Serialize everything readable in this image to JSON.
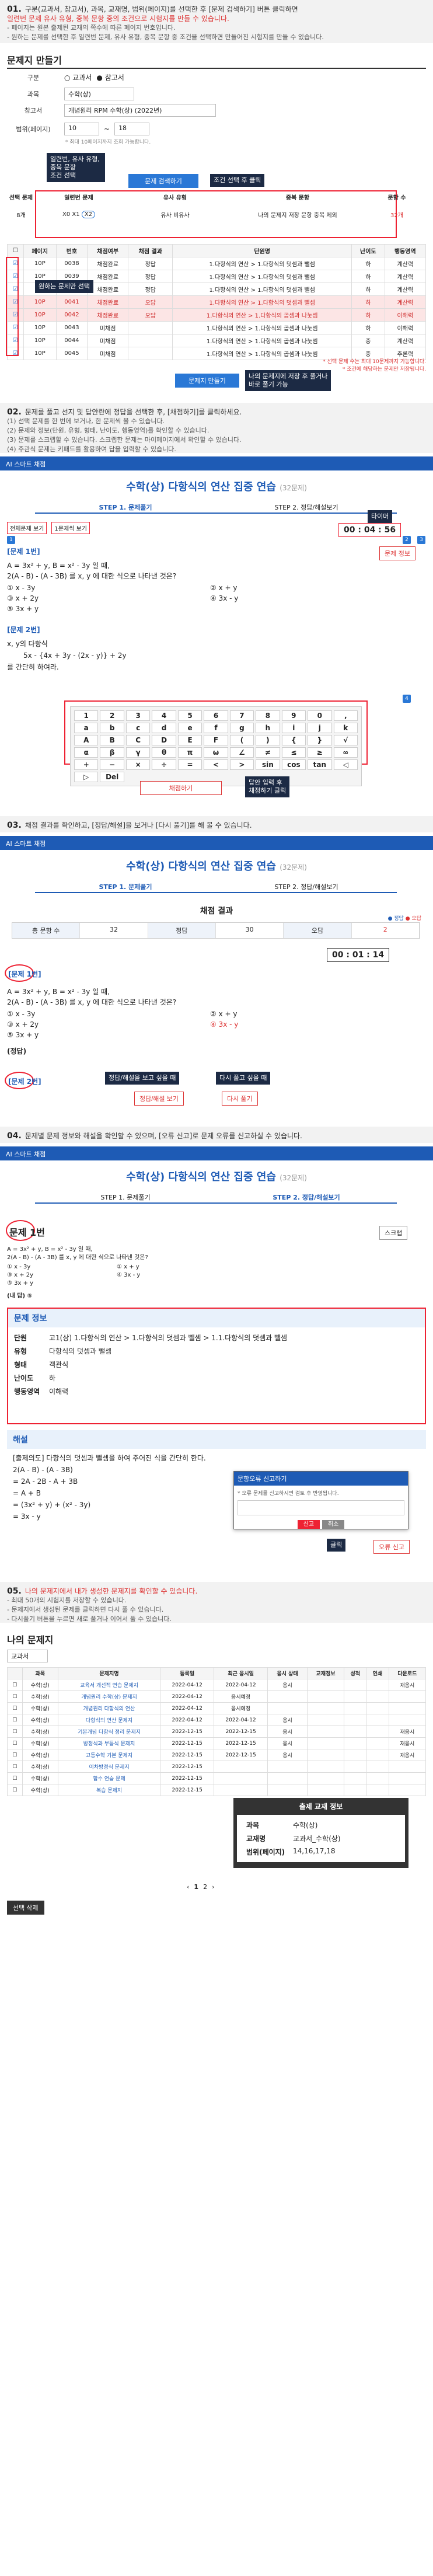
{
  "s1": {
    "num": "01.",
    "lines": [
      "구분(교과서, 참고서), 과목, 교재명, 범위(페이지)를 선택한 후 [문제 검색하기] 버튼 클릭하면",
      "일련번 문제 유사 유형, 중복 문항 중의 조건으로 시험지를 만들 수 있습니다.",
      "- 페이지는 원본 출제된 교재의 쪽수에 따른 페이지 번호입니다.",
      "- 원하는 문제를 선택한 후 일련번 문제, 유사 유형, 중복 문항 중 조건을 선택하면 만들어진 시험지를 만들 수 있습니다."
    ],
    "heading": "문제지 만들기",
    "form": {
      "gubun_label": "구분",
      "gubun_options": [
        "교과서",
        "참고서"
      ],
      "subject_label": "과목",
      "subject_value": "수학(상)",
      "book_label": "참고서",
      "book_value": "개념원리 RPM 수학(상) (2022년)",
      "range_label": "범위(페이지)",
      "range_from": "10",
      "range_to": "18",
      "range_help": "* 최대 10페이지까지 조회 가능합니다."
    },
    "search_button": "문제 검색하기",
    "callout_search": "조건 선택 후 클릭",
    "callout_types": "일련번, 유사 유형, 중복 문항\n조건 선택",
    "filter_cols": [
      "선택 문제",
      "일련번 문제",
      "유사 유형",
      "중복 문항",
      "문항 수"
    ],
    "filter_sub": [
      "X0",
      "X1",
      "X2",
      "X3",
      "유사",
      "비유사",
      "X0",
      "X1",
      "X2",
      "나의 문제지 저장 문항",
      "중복",
      "제외"
    ],
    "filter_count": "32개",
    "table_headers": [
      "",
      "페이지",
      "번호",
      "채점여부",
      "채점 결과",
      "",
      "단원명",
      "난이도",
      "행동영역"
    ],
    "rows": [
      [
        "10P",
        "0038",
        "채점완료",
        "정답",
        "1.다항식의 연산 > 1.다항식의 덧셈과 뺄셈",
        "하",
        "계산력"
      ],
      [
        "10P",
        "0039",
        "채점완료",
        "정답",
        "1.다항식의 연산 > 1.다항식의 덧셈과 뺄셈",
        "하",
        "계산력"
      ],
      [
        "10P",
        "0040",
        "채점완료",
        "정답",
        "1.다항식의 연산 > 1.다항식의 덧셈과 뺄셈",
        "하",
        "계산력"
      ],
      [
        "10P",
        "0041",
        "채점완료",
        "오답",
        "1.다항식의 연산 > 1.다항식의 덧셈과 뺄셈",
        "하",
        "계산력"
      ],
      [
        "10P",
        "0042",
        "채점완료",
        "오답",
        "1.다항식의 연산 > 1.다항식의 곱셈과 나눗셈",
        "하",
        "이해력"
      ],
      [
        "10P",
        "0043",
        "미채점",
        "",
        "1.다항식의 연산 > 1.다항식의 곱셈과 나눗셈",
        "하",
        "이해력"
      ],
      [
        "10P",
        "0044",
        "미채점",
        "",
        "1.다항식의 연산 > 1.다항식의 곱셈과 나눗셈",
        "중",
        "계산력"
      ],
      [
        "10P",
        "0045",
        "미채점",
        "",
        "1.다항식의 연산 > 1.다항식의 곱셈과 나눗셈",
        "중",
        "추론력"
      ]
    ],
    "callout_select": "원하는 문제만 선택",
    "right_note": "* 선택 문제 수는 최대 10문제까지 가능합니다.\n* 조건에 해당하는 문제만 저장됩니다.",
    "make_button": "문제지 만들기",
    "callout_make": "나의 문제지에 저장 후 풀거나\n바로 풀기 가능"
  },
  "s2": {
    "num": "02.",
    "lines": [
      "문제를 풀고 선지 및 답안란에 정답을 선택한 후, [채점하기]를 클릭하세요.",
      "(1) 선택 문제를 한 번에 보거나, 한 문제씩 볼 수 있습니다.",
      "(2) 문제와 정보(단원, 유형, 형태, 난이도, 행동영역)를 확인할 수 있습니다.",
      "(3) 문제를 스크랩할 수 있습니다. 스크랩한 문제는 마이페이지에서 확인할 수 있습니다.",
      "(4) 주관식 문제는 키패드를 활용하여 답을 입력할 수 있습니다."
    ],
    "bar": "AI 스마트 채점",
    "title": "수학(상) 다항식의 연산 집중 연습",
    "title_count": "(32문제)",
    "step1": "STEP 1. 문제풀기",
    "step2": "STEP 2. 정답/해설보기",
    "toggles": [
      "전체문제 보기",
      "1문제씩 보기"
    ],
    "timer": "00 : 04 : 56",
    "timer_label": "타이머",
    "info_btn": "문제 정보",
    "q1_label": "[문제 1번]",
    "q1_text": "A = 3x² + y, B = x² - 3y 일 때,",
    "q1_text2": "2(A - B) - (A - 3B) 를 x, y 에 대한 식으로 나타낸 것은?",
    "q1_choices": [
      "① x - 3y",
      "② x + y",
      "③ x + 2y",
      "④ 3x - y",
      "⑤ 3x + y"
    ],
    "q2_label": "[문제 2번]",
    "q2_text": "x, y의 다항식",
    "q2_expr": "5x - {4x + 3y - (2x - y)} + 2y",
    "q2_text2": "를 간단히 하여라.",
    "keys": [
      "1",
      "2",
      "3",
      "4",
      "5",
      "6",
      "7",
      "8",
      "9",
      "0",
      ",",
      "a",
      "b",
      "c",
      "d",
      "e",
      "f",
      "g",
      "h",
      "i",
      "j",
      "k",
      "A",
      "B",
      "C",
      "D",
      "E",
      "F",
      "(",
      ")",
      "{",
      "}",
      "√",
      "α",
      "β",
      "γ",
      "θ",
      "π",
      "ω",
      "∠",
      "≠",
      "≤",
      "≥",
      "∞",
      "+",
      "−",
      "×",
      "÷",
      "=",
      "<",
      ">",
      "sin",
      "cos",
      "tan",
      "◁",
      "▷",
      "Del"
    ],
    "grade_button": "채점하기",
    "callout_grade": "답안 입력 후\n채점하기 클릭"
  },
  "s3": {
    "num": "03.",
    "lines": [
      "채점 결과를 확인하고, [정답/해설]을 보거나 [다시 풀기]를 해 볼 수 있습니다."
    ],
    "bar": "AI 스마트 채점",
    "title": "수학(상) 다항식의 연산 집중 연습",
    "title_count": "(32문제)",
    "step1": "STEP 1. 문제풀기",
    "step2": "STEP 2. 정답/해설보기",
    "result_title": "채점 결과",
    "legend": [
      "정답",
      "오답"
    ],
    "score": [
      "총 문항 수",
      "32",
      "정답",
      "30",
      "오답",
      "2"
    ],
    "timer": "00 : 01 : 14",
    "q1_label": "[문제 1번]",
    "q1_text": "A = 3x² + y, B = x² - 3y 일 때,",
    "q1_text2": "2(A - B) - (A - 3B) 를 x, y 에 대한 식으로 나타낸 것은?",
    "q1_choices": [
      "① x - 3y",
      "② x + y",
      "③ x + 2y",
      "④ 3x - y",
      "⑤ 3x + y"
    ],
    "answer_label": "(정답)",
    "q2_label": "[문제 2번]",
    "callout_ans": "정답/해설을 보고 싶을 때",
    "callout_retry": "다시 풀고 싶을 때",
    "ans_button": "정답/해설 보기",
    "retry_button": "다시 풀기"
  },
  "s4": {
    "num": "04.",
    "lines": [
      "문제별 문제 정보와 해설을 확인할 수 있으며, [오류 신고]로 문제 오류를 신고하실 수 있습니다."
    ],
    "bar": "AI 스마트 채점",
    "title": "수학(상) 다항식의 연산 집중 연습",
    "title_count": "(32문제)",
    "step1": "STEP 1. 문제풀기",
    "step2": "STEP 2. 정답/해설보기",
    "q_label": "문제 1번",
    "scrap": "스크랩",
    "q_text": "A = 3x² + y, B = x² - 3y 일 때,",
    "q_text2": "2(A - B) - (A - 3B) 를 x, y 에 대한 식으로 나타낸 것은?",
    "q_choices": [
      "① x - 3y",
      "② x + y",
      "③ x + 2y",
      "④ 3x - y",
      "⑤ 3x + y"
    ],
    "my_answer": "(내 답) ⑤",
    "info_title": "문제 정보",
    "info": [
      [
        "단원",
        "고1(상) 1.다항식의 연산 > 1.다항식의 덧셈과 뺄셈 > 1.1.다항식의 덧셈과 뺄셈"
      ],
      [
        "유형",
        "다항식의 덧셈과 뺄셈"
      ],
      [
        "형태",
        "객관식"
      ],
      [
        "난이도",
        "하"
      ],
      [
        "행동영역",
        "이해력"
      ]
    ],
    "exp_title": "해설",
    "exp_lines": [
      "[출제의도] 다항식의 덧셈과 뺄셈을 하여 주어진 식을 간단히 한다.",
      "2(A - B) - (A - 3B)",
      "= 2A - 2B - A + 3B",
      "= A + B",
      "= (3x² + y) + (x² - 3y)",
      "= 3x - y"
    ],
    "popup_title": "문항오류 신고하기",
    "popup_text": "* 오류 문제를 신고하시면 검토 후 반영됩니다.",
    "popup_ok": "신고",
    "popup_cancel": "취소",
    "click_label": "클릭",
    "report_button": "오류 신고"
  },
  "s5": {
    "num": "05.",
    "lines": [
      "나의 문제지에서 내가 생성한 문제지를 확인할 수 있습니다.",
      "- 최대 50개의 시험지를 저장할 수 있습니다.",
      "- 문제지에서 생성된 문제를 클릭하면 다시 풀 수 있습니다.",
      "- 다시풀기 버튼을 누르면 새로 풀거나 이어서 풀 수 있습니다."
    ],
    "heading": "나의 문제지",
    "filter": "교과서",
    "headers": [
      "",
      "과목",
      "문제지명",
      "등록일",
      "최근 응시일",
      "응시 상태",
      "교재정보",
      "성적",
      "인쇄",
      "다운로드"
    ],
    "rows": [
      [
        "수학(상)",
        "교육서 개선적 연습 문제지",
        "2022-04-12",
        "2022-04-12",
        "응시",
        "",
        "",
        "",
        "재응시"
      ],
      [
        "수학(상)",
        "개념원리 수학(상) 문제지",
        "2022-04-12",
        "응시예정",
        "",
        "",
        "",
        "",
        ""
      ],
      [
        "수학(상)",
        "개념원리 다항식의 연산",
        "2022-04-12",
        "응시예정",
        "",
        "",
        "",
        "",
        ""
      ],
      [
        "수학(상)",
        "다항식의 연산 문제지",
        "2022-04-12",
        "2022-04-12",
        "응시",
        "",
        "",
        "",
        ""
      ],
      [
        "수학(상)",
        "기본개념 다항식 정리 문제지",
        "2022-12-15",
        "2022-12-15",
        "응시",
        "",
        "",
        "",
        "재응시"
      ],
      [
        "수학(상)",
        "방정식과 부등식 문제지",
        "2022-12-15",
        "2022-12-15",
        "응시",
        "",
        "",
        "",
        "재응시"
      ],
      [
        "수학(상)",
        "고등수학 기본 문제지",
        "2022-12-15",
        "2022-12-15",
        "응시",
        "",
        "",
        "",
        "재응시"
      ],
      [
        "수학(상)",
        "이차방정식 문제지",
        "2022-12-15",
        "",
        "",
        "",
        "",
        "",
        ""
      ],
      [
        "수학(상)",
        "함수 연습 문제",
        "2022-12-15",
        "",
        "",
        "",
        "",
        "",
        ""
      ],
      [
        "수학(상)",
        "복습 문제지",
        "2022-12-15",
        "",
        "",
        "",
        "",
        "",
        ""
      ]
    ],
    "detail_title": "출제 교재 정보",
    "detail": [
      [
        "과목",
        "수학(상)"
      ],
      [
        "교재명",
        "교과서_수학(상)"
      ],
      [
        "범위(페이지)",
        "14,16,17,18"
      ]
    ],
    "pager": [
      "‹",
      "1",
      "2",
      "›"
    ],
    "delete_button": "선택 삭제"
  }
}
